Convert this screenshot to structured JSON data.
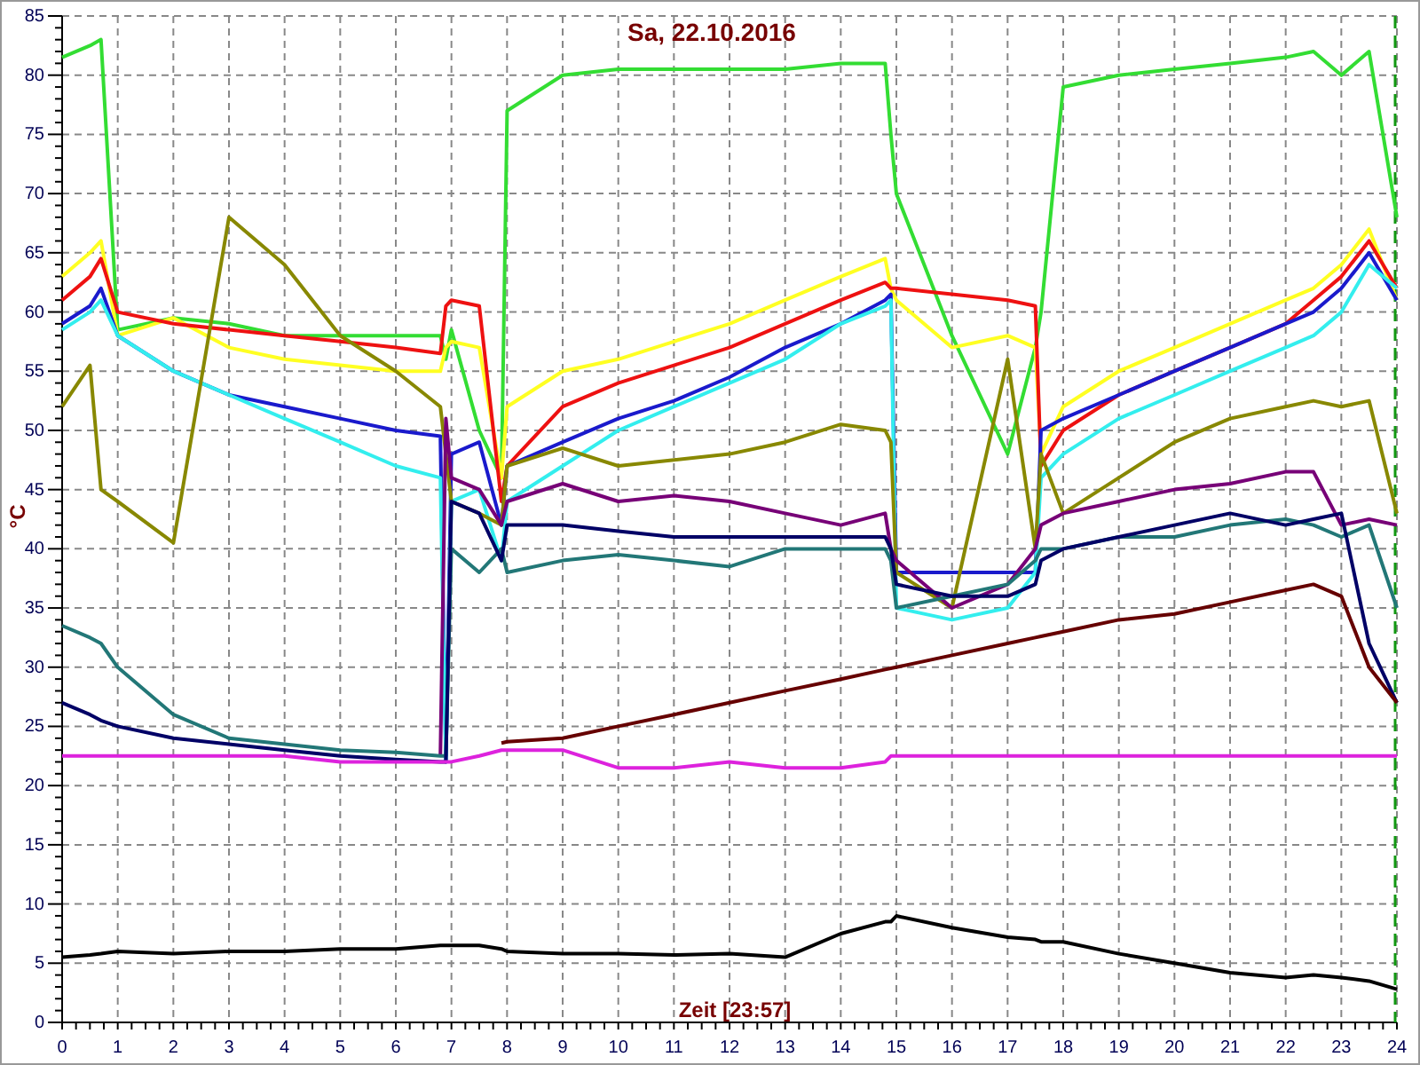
{
  "chart_data": {
    "type": "line",
    "grid": true,
    "title": "Sa, 22.10.2016",
    "xlabel": "Zeit [23:57]",
    "ylabel": "°C",
    "xlim": [
      0,
      24
    ],
    "ylim": [
      0,
      85
    ],
    "xticks": [
      0,
      1,
      2,
      3,
      4,
      5,
      6,
      7,
      8,
      9,
      10,
      11,
      12,
      13,
      14,
      15,
      16,
      17,
      18,
      19,
      20,
      21,
      22,
      23,
      24
    ],
    "yticks": [
      0,
      5,
      10,
      15,
      20,
      25,
      30,
      35,
      40,
      45,
      50,
      55,
      60,
      65,
      70,
      75,
      80,
      85
    ],
    "x": [
      0,
      0.5,
      0.7,
      1,
      2,
      3,
      4,
      5,
      6,
      6.8,
      6.9,
      7,
      7.5,
      7.9,
      8,
      9,
      10,
      11,
      12,
      13,
      14,
      14.8,
      14.9,
      15,
      16,
      17,
      17.5,
      17.6,
      18,
      19,
      20,
      21,
      22,
      22.5,
      23,
      23.5,
      24
    ],
    "series": [
      {
        "color": "#33dd33",
        "values": [
          81.5,
          82.5,
          83,
          58.5,
          59.5,
          59,
          58,
          58,
          58,
          58,
          56,
          58.5,
          50,
          46,
          77,
          80,
          80.5,
          80.5,
          80.5,
          80.5,
          81,
          81,
          75,
          70,
          58,
          48,
          57,
          60,
          79,
          80,
          80.5,
          81,
          81.5,
          82,
          80,
          82,
          68
        ]
      },
      {
        "color": "#ffff22",
        "values": [
          63,
          65,
          66,
          58,
          59.5,
          57,
          56,
          55.5,
          55,
          55,
          57,
          57.5,
          57,
          46,
          52,
          55,
          56,
          57.5,
          59,
          61,
          63,
          64.5,
          62,
          61,
          57,
          58,
          57,
          48,
          52,
          55,
          57,
          59,
          61,
          62,
          64,
          67,
          61
        ]
      },
      {
        "color": "#ee1111",
        "values": [
          61,
          63,
          64.5,
          60,
          59,
          58.5,
          58,
          57.5,
          57,
          56.5,
          60.5,
          61,
          60.5,
          44,
          47,
          52,
          54,
          55.5,
          57,
          59,
          61,
          62.5,
          62,
          62,
          61.5,
          61,
          60.5,
          47,
          50,
          53,
          55,
          57,
          59,
          61,
          63,
          66,
          62
        ]
      },
      {
        "color": "#1a1acc",
        "values": [
          59,
          60.5,
          62,
          58,
          55,
          53,
          52,
          51,
          50,
          49.5,
          22,
          48,
          49,
          42,
          47,
          49,
          51,
          52.5,
          54.5,
          57,
          59,
          61,
          61.5,
          38,
          38,
          38,
          38,
          50,
          51,
          53,
          55,
          57,
          59,
          60,
          62,
          65,
          61
        ]
      },
      {
        "color": "#33eeee",
        "values": [
          58.5,
          60,
          61,
          58,
          55,
          53,
          51,
          49,
          47,
          46,
          22,
          44,
          45,
          39,
          44,
          47,
          50,
          52,
          54,
          56,
          59,
          60.5,
          61,
          35,
          34,
          35,
          38,
          46,
          48,
          51,
          53,
          55,
          57,
          58,
          60,
          64,
          62
        ]
      },
      {
        "color": "#888800",
        "values": [
          52,
          55.5,
          45,
          44,
          40.5,
          68,
          64,
          58,
          55,
          52,
          48,
          44,
          43,
          42,
          47,
          48.5,
          47,
          47.5,
          48,
          49,
          50.5,
          50,
          49,
          38,
          35,
          56,
          40,
          48,
          43,
          46,
          49,
          51,
          52,
          52.5,
          52,
          52.5,
          43
        ]
      },
      {
        "color": "#770077",
        "values": [
          null,
          null,
          null,
          null,
          null,
          null,
          null,
          null,
          null,
          22.5,
          51,
          46,
          45,
          42,
          44,
          45.5,
          44,
          44.5,
          44,
          43,
          42,
          43,
          40,
          39,
          35,
          37,
          40,
          42,
          43,
          44,
          45,
          45.5,
          46.5,
          46.5,
          42,
          42.5,
          42
        ]
      },
      {
        "color": "#227777",
        "values": [
          33.5,
          32.5,
          32,
          30,
          26,
          24,
          23.5,
          23,
          22.8,
          22.5,
          22.5,
          40,
          38,
          40,
          38,
          39,
          39.5,
          39,
          38.5,
          40,
          40,
          40,
          39,
          35,
          36,
          37,
          39,
          40,
          40,
          41,
          41,
          42,
          42.5,
          42,
          41,
          42,
          35
        ]
      },
      {
        "color": "#000066",
        "values": [
          27,
          26,
          25.5,
          25,
          24,
          23.5,
          23,
          22.5,
          22.2,
          22,
          22,
          44,
          43,
          39,
          42,
          42,
          41.5,
          41,
          41,
          41,
          41,
          41,
          40,
          37,
          36,
          36,
          37,
          39,
          40,
          41,
          42,
          43,
          42,
          42.5,
          43,
          32,
          27
        ]
      },
      {
        "color": "#660000",
        "values": [
          null,
          null,
          null,
          null,
          null,
          null,
          null,
          null,
          null,
          null,
          null,
          null,
          null,
          23.6,
          23.7,
          24,
          25,
          26,
          27,
          28,
          29,
          29.8,
          29.9,
          30,
          31,
          32,
          32.5,
          32.6,
          33,
          34,
          34.5,
          35.5,
          36.5,
          37,
          36,
          30,
          27
        ]
      },
      {
        "color": "#dd22dd",
        "values": [
          22.5,
          22.5,
          22.5,
          22.5,
          22.5,
          22.5,
          22.5,
          22,
          22,
          22,
          22,
          22,
          22.5,
          23,
          23,
          23,
          21.5,
          21.5,
          22,
          21.5,
          21.5,
          22,
          22.5,
          22.5,
          22.5,
          22.5,
          22.5,
          22.5,
          22.5,
          22.5,
          22.5,
          22.5,
          22.5,
          22.5,
          22.5,
          22.5,
          22.5
        ]
      },
      {
        "color": "#000000",
        "values": [
          5.5,
          5.7,
          5.8,
          6,
          5.8,
          6,
          6,
          6.2,
          6.2,
          6.5,
          6.5,
          6.5,
          6.5,
          6.2,
          6,
          5.8,
          5.8,
          5.7,
          5.8,
          5.5,
          7.5,
          8.5,
          8.5,
          9,
          8,
          7.2,
          7,
          6.8,
          6.8,
          5.8,
          5,
          4.2,
          3.8,
          4,
          3.8,
          3.5,
          2.8
        ]
      }
    ]
  }
}
